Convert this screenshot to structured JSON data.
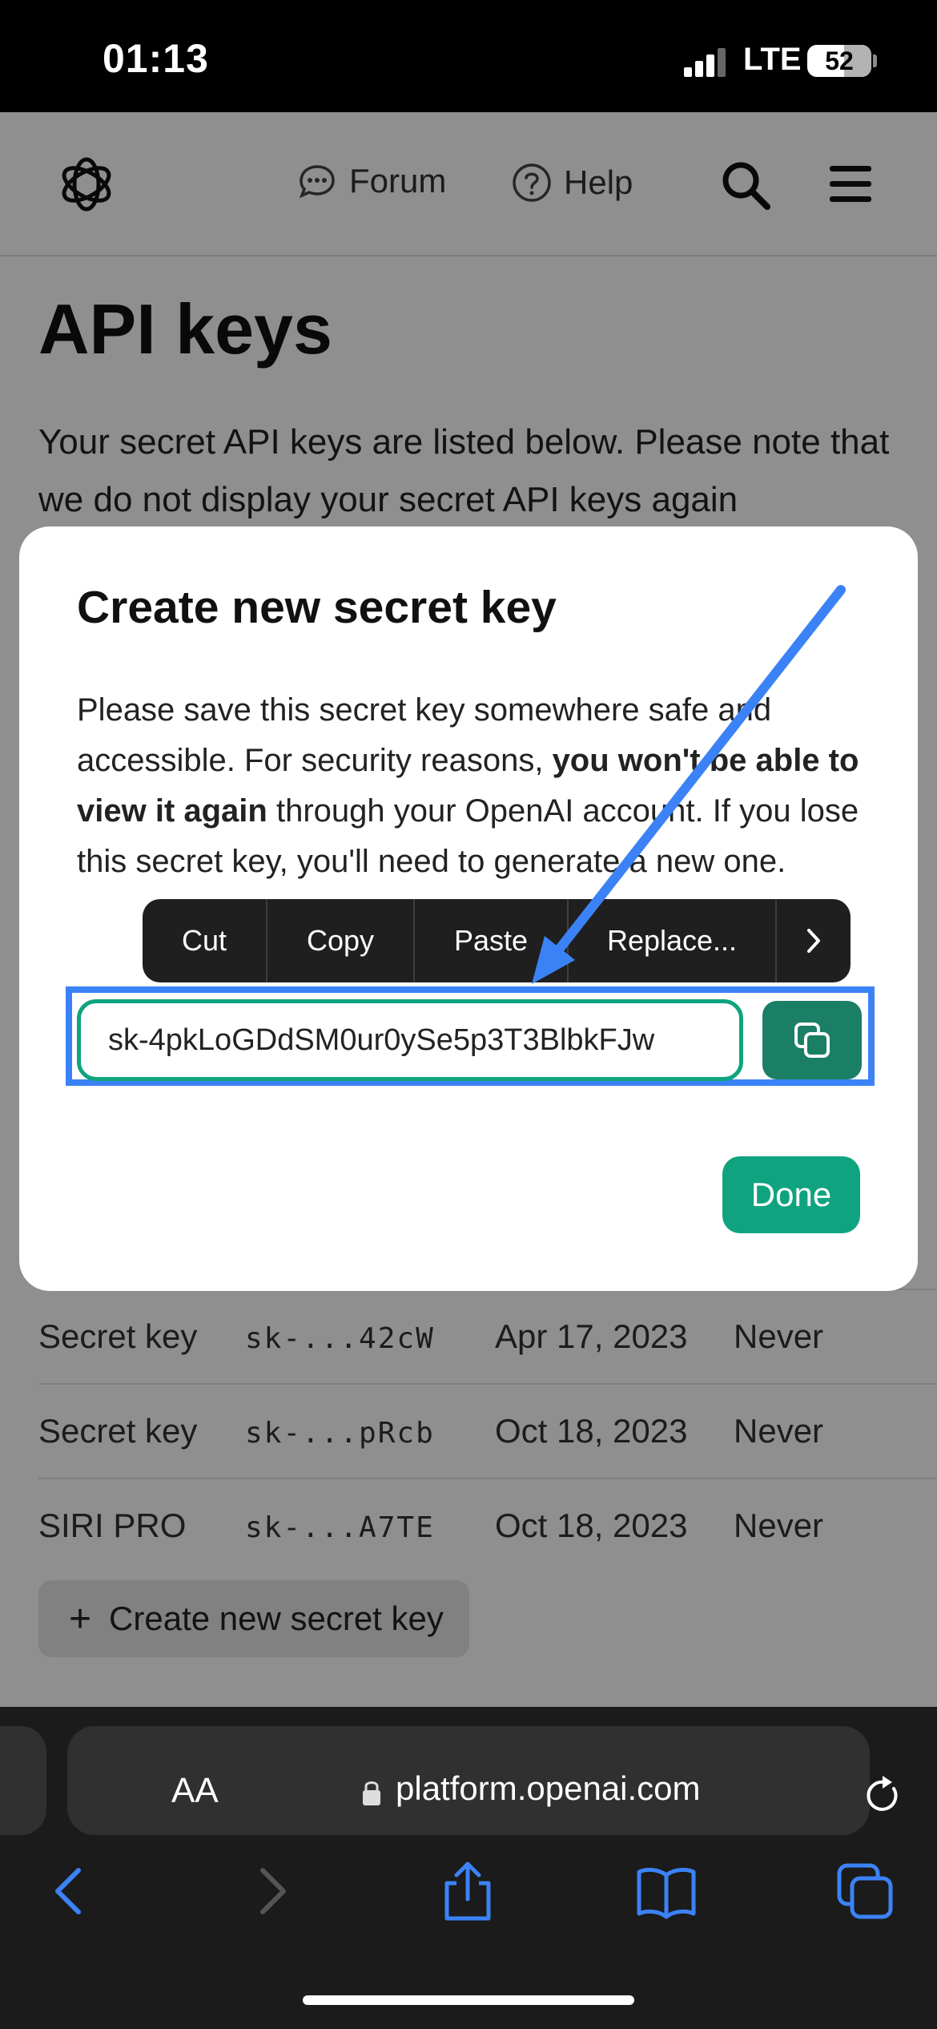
{
  "status_bar": {
    "time": "01:13",
    "network": "LTE",
    "battery": "52"
  },
  "header": {
    "forum_label": "Forum",
    "help_label": "Help"
  },
  "page": {
    "title": "API keys",
    "description": "Your secret API keys are listed below. Please note that we do not display your secret API keys again",
    "rows": [
      {
        "name": "Secret key",
        "key": "sk-...42cW",
        "created": "Apr 17, 2023",
        "last_used": "Never"
      },
      {
        "name": "Secret key",
        "key": "sk-...pRcb",
        "created": "Oct 18, 2023",
        "last_used": "Never"
      },
      {
        "name": "SIRI PRO",
        "key": "sk-...A7TE",
        "created": "Oct 18, 2023",
        "last_used": "Never"
      }
    ],
    "create_button_label": "Create new secret key"
  },
  "dialog": {
    "title": "Create new secret key",
    "body_part1": "Please save this secret key somewhere safe and accessible. For security reasons, ",
    "body_bold": "you won't be able to view it again",
    "body_part2": " through your OpenAI account. If you lose this secret key, you'll need to generate a new one.",
    "secret_key": "sk-4pkLoGDdSM0ur0ySe5p3T3BlbkFJw",
    "done_label": "Done"
  },
  "context_menu": {
    "items": [
      "Cut",
      "Copy",
      "Paste",
      "Replace..."
    ]
  },
  "safari": {
    "aa_label": "AA",
    "url": "platform.openai.com"
  },
  "colors": {
    "accent": "#10a37f",
    "copy_button": "#1a7f64",
    "highlight": "#3b82f6",
    "safari_blue": "#3b82f6"
  }
}
